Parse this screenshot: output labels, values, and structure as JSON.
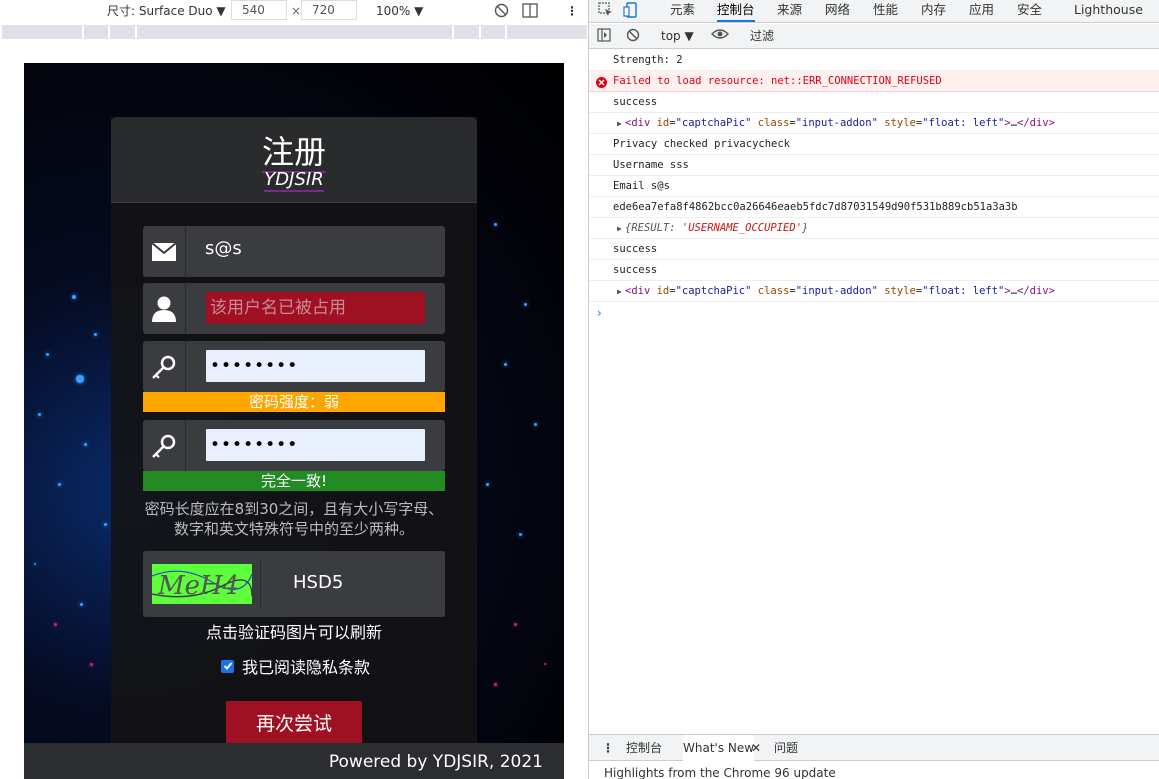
{
  "device_toolbar": {
    "dimensions_label": "尺寸: Surface Duo ▼",
    "width": "540",
    "times": "×",
    "height": "720",
    "zoom": "100% ▼"
  },
  "page": {
    "title": "注册",
    "subtitle": "YDJSIR",
    "email_value": "s@s",
    "username_error": "该用户名已被占用",
    "password_mask": "••••••••",
    "strength_label": "密码强度：弱",
    "confirm_mask": "••••••••",
    "match_label": "完全一致!",
    "hint": "密码长度应在8到30之间，且有大小写字母、数字和英文特殊符号中的至少两种。",
    "captcha_image_text": "MeH4",
    "captcha_value": "HSD5",
    "captcha_tip": "点击验证码图片可以刷新",
    "privacy_label": "我已阅读隐私条款",
    "retry_button": "再次尝试",
    "footer": "Powered by YDJSIR, 2021",
    "colors": {
      "error": "#9e1022",
      "weak": "#ffa500",
      "match": "#228b22",
      "input_bg": "#e8f0fe"
    }
  },
  "devtools": {
    "tabs": [
      "元素",
      "控制台",
      "来源",
      "网络",
      "性能",
      "内存",
      "应用",
      "安全",
      "Lighthouse"
    ],
    "active_tab": "控制台",
    "context": "top ▼",
    "filter_placeholder": "过滤",
    "logs": {
      "l1": "Strength: 2",
      "l2": "Failed to load resource: net::ERR_CONNECTION_REFUSED",
      "l3": "success",
      "l5": "Privacy checked privacycheck",
      "l6": "Username sss",
      "l7": "Email s@s",
      "l8": "ede6ea7efa8f4862bcc0a26646eaeb5fdc7d87031549d90f531b889cb51a3a3b",
      "l10": "success",
      "l11": "success"
    },
    "drawer_tabs": [
      "控制台",
      "What's New",
      "问题"
    ],
    "drawer_content": "Highlights from the Chrome 96 update"
  }
}
